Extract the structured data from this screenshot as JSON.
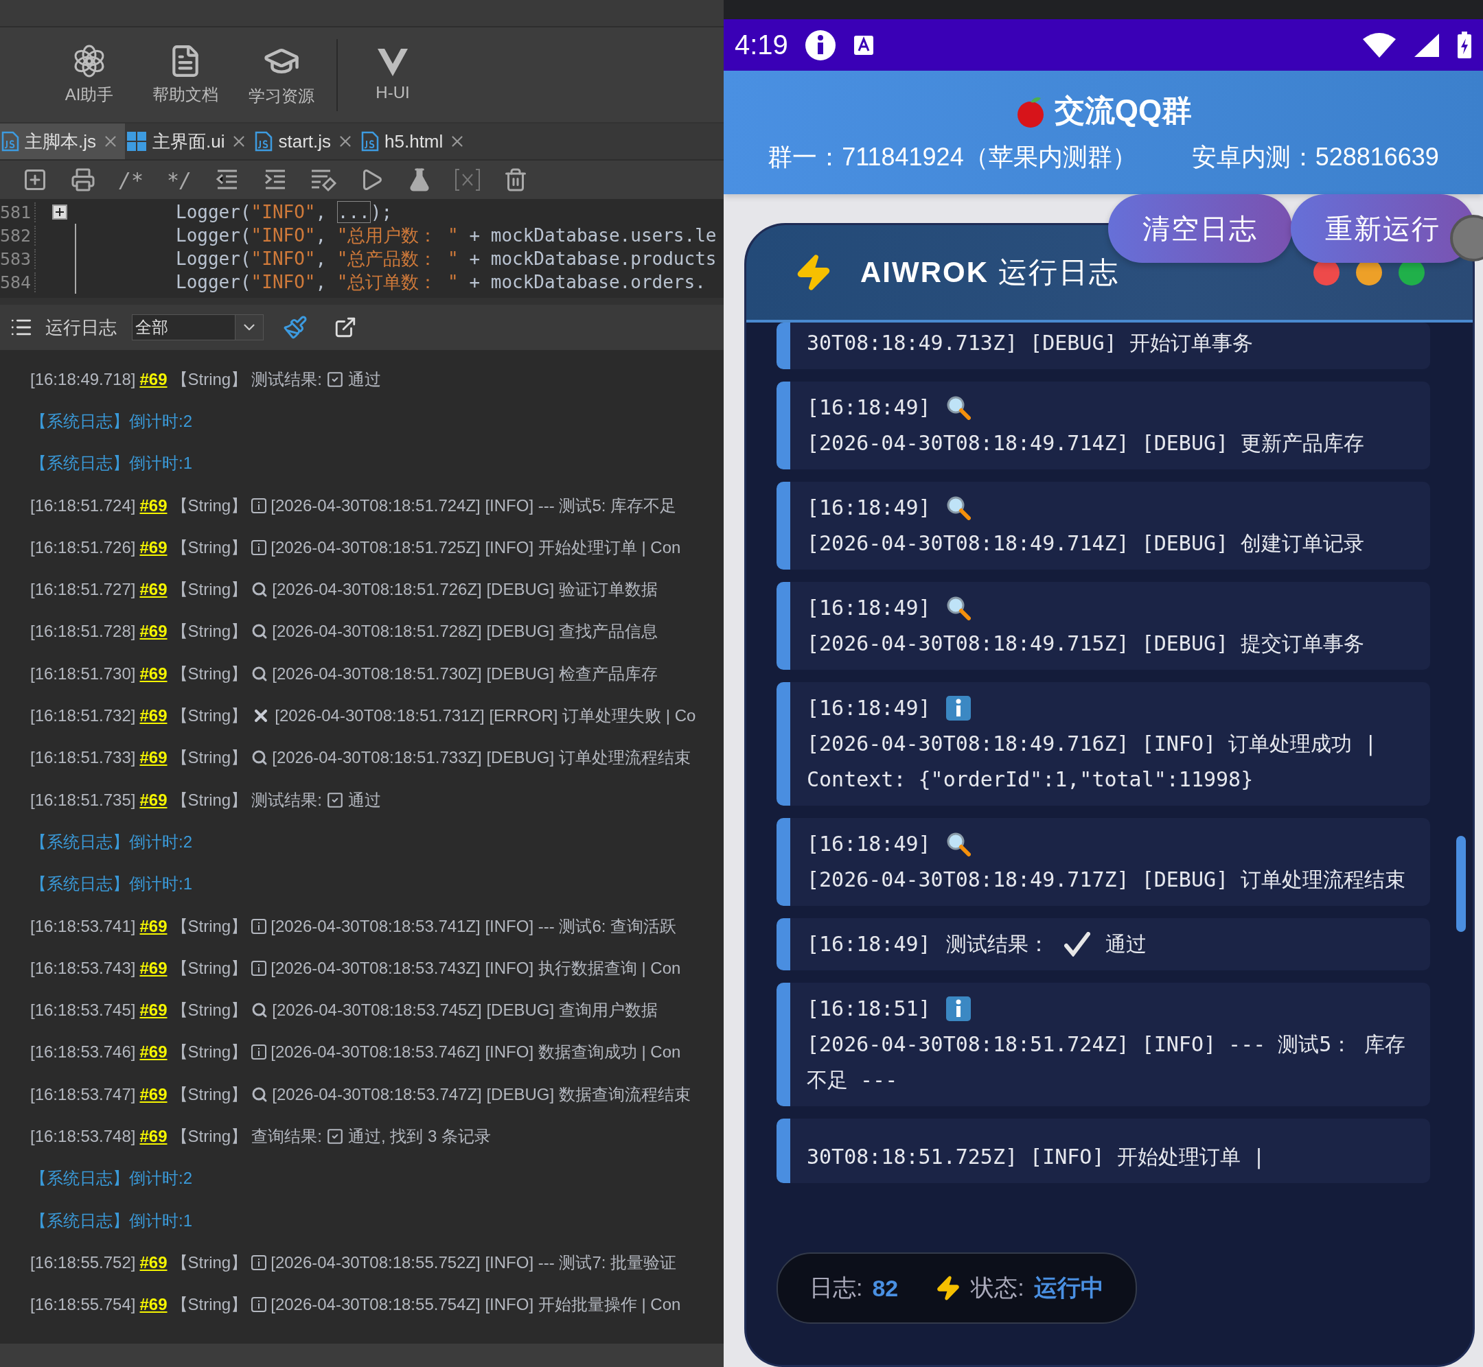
{
  "ide": {
    "toolbar": [
      {
        "kind": "ai",
        "label": "AI助手"
      },
      {
        "kind": "docs",
        "label": "帮助文档"
      },
      {
        "kind": "learn",
        "label": "学习资源"
      },
      {
        "kind": "hui",
        "label": "H-UI"
      }
    ],
    "file_tabs": [
      {
        "kind": "js",
        "label": "主脚本.js",
        "selected": true
      },
      {
        "kind": "ui",
        "label": "主界面.ui",
        "selected": false
      },
      {
        "kind": "js",
        "label": "start.js",
        "selected": false
      },
      {
        "kind": "js",
        "label": "h5.html",
        "selected": false
      }
    ],
    "editor_tools": [
      {
        "kind": "add"
      },
      {
        "kind": "print"
      },
      {
        "kind": "text",
        "label": "/*"
      },
      {
        "kind": "text",
        "label": "*/"
      },
      {
        "kind": "outdent"
      },
      {
        "kind": "indent"
      },
      {
        "kind": "format"
      },
      {
        "kind": "run"
      },
      {
        "kind": "test"
      },
      {
        "kind": "variable"
      },
      {
        "kind": "clear"
      }
    ],
    "code_lines": [
      {
        "number": "581",
        "folded": true,
        "segments": [
          {
            "kind": "plain",
            "text": "Logger("
          },
          {
            "kind": "string",
            "text": "\"INFO\""
          },
          {
            "kind": "plain",
            "text": ", "
          },
          {
            "kind": "fold",
            "text": "..."
          },
          {
            "kind": "plain",
            "text": ");"
          }
        ]
      },
      {
        "number": "582",
        "folded": false,
        "segments": [
          {
            "kind": "plain",
            "text": "Logger("
          },
          {
            "kind": "string",
            "text": "\"INFO\""
          },
          {
            "kind": "plain",
            "text": ", "
          },
          {
            "kind": "string",
            "text": "\"总用户数： \""
          },
          {
            "kind": "plain",
            "text": " + mockDatabase.users.le"
          }
        ]
      },
      {
        "number": "583",
        "folded": false,
        "segments": [
          {
            "kind": "plain",
            "text": "Logger("
          },
          {
            "kind": "string",
            "text": "\"INFO\""
          },
          {
            "kind": "plain",
            "text": ", "
          },
          {
            "kind": "string",
            "text": "\"总产品数： \""
          },
          {
            "kind": "plain",
            "text": " + mockDatabase.products"
          }
        ]
      },
      {
        "number": "584",
        "folded": false,
        "segments": [
          {
            "kind": "plain",
            "text": "Logger("
          },
          {
            "kind": "string",
            "text": "\"INFO\""
          },
          {
            "kind": "plain",
            "text": ", "
          },
          {
            "kind": "string",
            "text": "\"总订单数： \""
          },
          {
            "kind": "plain",
            "text": " + mockDatabase.orders."
          }
        ]
      }
    ],
    "log_panel": {
      "title": "运行日志",
      "filter": "全部",
      "lines": [
        {
          "kind": "result",
          "time": "[16:18:49.718]",
          "tag": "#69",
          "type": "【String】",
          "label": "测试结果:",
          "value": "通过"
        },
        {
          "kind": "system",
          "text": "【系统日志】倒计时:2"
        },
        {
          "kind": "system",
          "text": "【系统日志】倒计时:1"
        },
        {
          "kind": "info",
          "time": "[16:18:51.724]",
          "tag": "#69",
          "type": "【String】",
          "message": "[2026-04-30T08:18:51.724Z] [INFO] --- 测试5: 库存不足"
        },
        {
          "kind": "info",
          "time": "[16:18:51.726]",
          "tag": "#69",
          "type": "【String】",
          "message": "[2026-04-30T08:18:51.725Z] [INFO] 开始处理订单 | Con"
        },
        {
          "kind": "debug",
          "time": "[16:18:51.727]",
          "tag": "#69",
          "type": "【String】",
          "message": "[2026-04-30T08:18:51.726Z] [DEBUG] 验证订单数据"
        },
        {
          "kind": "debug",
          "time": "[16:18:51.728]",
          "tag": "#69",
          "type": "【String】",
          "message": "[2026-04-30T08:18:51.728Z] [DEBUG] 查找产品信息"
        },
        {
          "kind": "debug",
          "time": "[16:18:51.730]",
          "tag": "#69",
          "type": "【String】",
          "message": "[2026-04-30T08:18:51.730Z] [DEBUG] 检查产品库存"
        },
        {
          "kind": "error",
          "time": "[16:18:51.732]",
          "tag": "#69",
          "type": "【String】",
          "message": "[2026-04-30T08:18:51.731Z] [ERROR] 订单处理失败 | Co"
        },
        {
          "kind": "debug",
          "time": "[16:18:51.733]",
          "tag": "#69",
          "type": "【String】",
          "message": "[2026-04-30T08:18:51.733Z] [DEBUG] 订单处理流程结束"
        },
        {
          "kind": "result",
          "time": "[16:18:51.735]",
          "tag": "#69",
          "type": "【String】",
          "label": "测试结果:",
          "value": "通过"
        },
        {
          "kind": "system",
          "text": "【系统日志】倒计时:2"
        },
        {
          "kind": "system",
          "text": "【系统日志】倒计时:1"
        },
        {
          "kind": "info",
          "time": "[16:18:53.741]",
          "tag": "#69",
          "type": "【String】",
          "message": "[2026-04-30T08:18:53.741Z] [INFO] --- 测试6: 查询活跃"
        },
        {
          "kind": "info",
          "time": "[16:18:53.743]",
          "tag": "#69",
          "type": "【String】",
          "message": "[2026-04-30T08:18:53.743Z] [INFO] 执行数据查询 | Con"
        },
        {
          "kind": "debug",
          "time": "[16:18:53.745]",
          "tag": "#69",
          "type": "【String】",
          "message": "[2026-04-30T08:18:53.745Z] [DEBUG] 查询用户数据"
        },
        {
          "kind": "info",
          "time": "[16:18:53.746]",
          "tag": "#69",
          "type": "【String】",
          "message": "[2026-04-30T08:18:53.746Z] [INFO] 数据查询成功 | Con"
        },
        {
          "kind": "debug",
          "time": "[16:18:53.747]",
          "tag": "#69",
          "type": "【String】",
          "message": "[2026-04-30T08:18:53.747Z] [DEBUG] 数据查询流程结束"
        },
        {
          "kind": "result",
          "time": "[16:18:53.748]",
          "tag": "#69",
          "type": "【String】",
          "label": "查询结果:",
          "value": "通过, 找到 3 条记录"
        },
        {
          "kind": "system",
          "text": "【系统日志】倒计时:2"
        },
        {
          "kind": "system",
          "text": "【系统日志】倒计时:1"
        },
        {
          "kind": "info",
          "time": "[16:18:55.752]",
          "tag": "#69",
          "type": "【String】",
          "message": "[2026-04-30T08:18:55.752Z] [INFO] --- 测试7: 批量验证"
        },
        {
          "kind": "info",
          "time": "[16:18:55.754]",
          "tag": "#69",
          "type": "【String】",
          "message": "[2026-04-30T08:18:55.754Z] [INFO] 开始批量操作 | Con"
        }
      ]
    }
  },
  "phone": {
    "status_bar": {
      "time": "4:19"
    },
    "header": {
      "title": "交流QQ群",
      "groups": [
        "群一：711841924（苹果内测群）",
        "安卓内测：528816639"
      ]
    },
    "buttons": [
      "清空日志",
      "重新运行"
    ],
    "log_card": {
      "brand": "AIWROK",
      "title": "运行日志",
      "entries": [
        {
          "kind": "partial",
          "message": "30T08:18:49.713Z] [DEBUG] 开始订单事务"
        },
        {
          "kind": "debug",
          "time": "[16:18:49]",
          "message": "[2026-04-30T08:18:49.714Z] [DEBUG] 更新产品库存"
        },
        {
          "kind": "debug",
          "time": "[16:18:49]",
          "message": "[2026-04-30T08:18:49.714Z] [DEBUG] 创建订单记录"
        },
        {
          "kind": "debug",
          "time": "[16:18:49]",
          "message": "[2026-04-30T08:18:49.715Z] [DEBUG] 提交订单事务"
        },
        {
          "kind": "info",
          "time": "[16:18:49]",
          "message": "[2026-04-30T08:18:49.716Z] [INFO] 订单处理成功 | Context: {\"orderId\":1,\"total\":11998}"
        },
        {
          "kind": "debug",
          "time": "[16:18:49]",
          "message": "[2026-04-30T08:18:49.717Z] [DEBUG] 订单处理流程结束"
        },
        {
          "kind": "result",
          "time": "[16:18:49]",
          "label": "测试结果：",
          "value": "通过"
        },
        {
          "kind": "info",
          "time": "[16:18:51]",
          "message": "[2026-04-30T08:18:51.724Z] [INFO] --- 测试5： 库存不足 ---"
        },
        {
          "kind": "covered",
          "message": "30T08:18:51.725Z] [INFO] 开始处理订单 |"
        }
      ]
    },
    "footer": {
      "count_label": "日志:",
      "count": "82",
      "state_label": "状态:",
      "state": "运行中"
    }
  }
}
